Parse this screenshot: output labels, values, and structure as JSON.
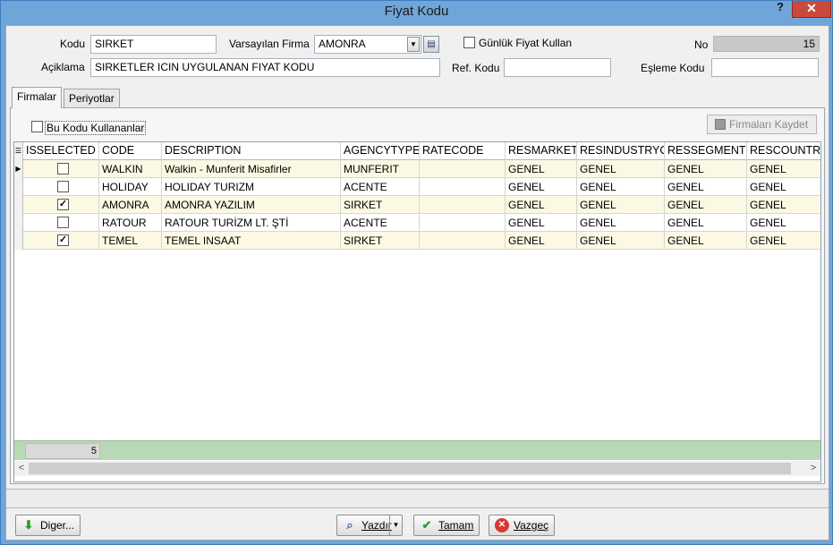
{
  "window": {
    "title": "Fiyat Kodu",
    "help": "?",
    "close": "✕"
  },
  "form": {
    "kodu_label": "Kodu",
    "kodu_value": "SIRKET",
    "varsayilan_firma_label": "Varsayılan Firma",
    "varsayilan_firma_value": "AMONRA",
    "gunluk_fiyat_label": "Günlük Fiyat Kullan",
    "gunluk_fiyat_checked": false,
    "no_label": "No",
    "no_value": "15",
    "aciklama_label": "Açiklama",
    "aciklama_value": "SIRKETLER ICIN UYGULANAN FIYAT KODU",
    "ref_kodu_label": "Ref. Kodu",
    "ref_kodu_value": "",
    "esleme_kodu_label": "Eşleme Kodu",
    "esleme_kodu_value": ""
  },
  "tabs": [
    {
      "label": "Firmalar",
      "active": true
    },
    {
      "label": "Periyotlar",
      "active": false
    }
  ],
  "firmalar": {
    "bu_kodu_label": "Bu Kodu Kullananlar",
    "bu_kodu_checked": false,
    "save_button": "Firmaları Kaydet"
  },
  "grid": {
    "columns": [
      "ISSELECTED",
      "CODE",
      "DESCRIPTION",
      "AGENCYTYPE",
      "RATECODE",
      "RESMARKET",
      "RESINDUSTRYC",
      "RESSEGMENTC",
      "RESCOUNTRY"
    ],
    "rows": [
      {
        "selected": false,
        "code": "WALKIN",
        "description": "Walkin - Munferit Misafirler",
        "agencytype": "MUNFERIT",
        "ratecode": "",
        "resmarket": "GENEL",
        "resindustry": "GENEL",
        "ressegment": "GENEL",
        "rescountry": "GENEL"
      },
      {
        "selected": false,
        "code": "HOLIDAY",
        "description": "HOLIDAY TURIZM",
        "agencytype": "ACENTE",
        "ratecode": "",
        "resmarket": "GENEL",
        "resindustry": "GENEL",
        "ressegment": "GENEL",
        "rescountry": "GENEL"
      },
      {
        "selected": true,
        "code": "AMONRA",
        "description": "AMONRA YAZILIM",
        "agencytype": "SIRKET",
        "ratecode": "",
        "resmarket": "GENEL",
        "resindustry": "GENEL",
        "ressegment": "GENEL",
        "rescountry": "GENEL"
      },
      {
        "selected": false,
        "code": "RATOUR",
        "description": "RATOUR TURİZM LT. ŞTİ",
        "agencytype": "ACENTE",
        "ratecode": "",
        "resmarket": "GENEL",
        "resindustry": "GENEL",
        "ressegment": "GENEL",
        "rescountry": "GENEL"
      },
      {
        "selected": true,
        "code": "TEMEL",
        "description": "TEMEL INSAAT",
        "agencytype": "SIRKET",
        "ratecode": "",
        "resmarket": "GENEL",
        "resindustry": "GENEL",
        "ressegment": "GENEL",
        "rescountry": "GENEL"
      }
    ],
    "footer_count": "5"
  },
  "buttons": {
    "diger": "Diger...",
    "yazdir": "Yazdır",
    "tamam": "Tamam",
    "vazgec": "Vazgeç"
  },
  "colors": {
    "title_bar": "#6fa5d8",
    "close": "#c94a3c",
    "row_alt": "#fbf9e3",
    "footer_green": "#b9d8b5"
  }
}
